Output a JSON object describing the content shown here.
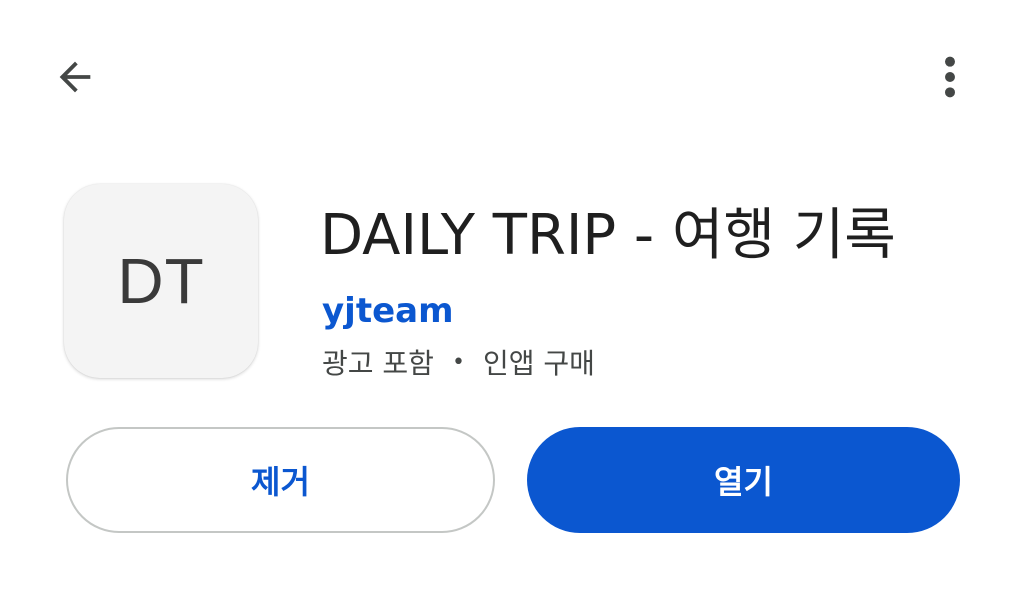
{
  "top_bar": {
    "back_icon": "arrow-back-icon",
    "more_icon": "more-vert-icon"
  },
  "app": {
    "icon_text": "DT",
    "title": "DAILY TRIP - 여행 기록",
    "developer": "yjteam",
    "meta": {
      "ads": "광고 포함",
      "separator": "•",
      "iap": "인앱 구매"
    }
  },
  "actions": {
    "uninstall_label": "제거",
    "open_label": "열기"
  },
  "colors": {
    "accent": "#0b57d0",
    "text_primary": "#1f1f1f",
    "text_secondary": "#444746",
    "outline": "#c4c7c5"
  }
}
